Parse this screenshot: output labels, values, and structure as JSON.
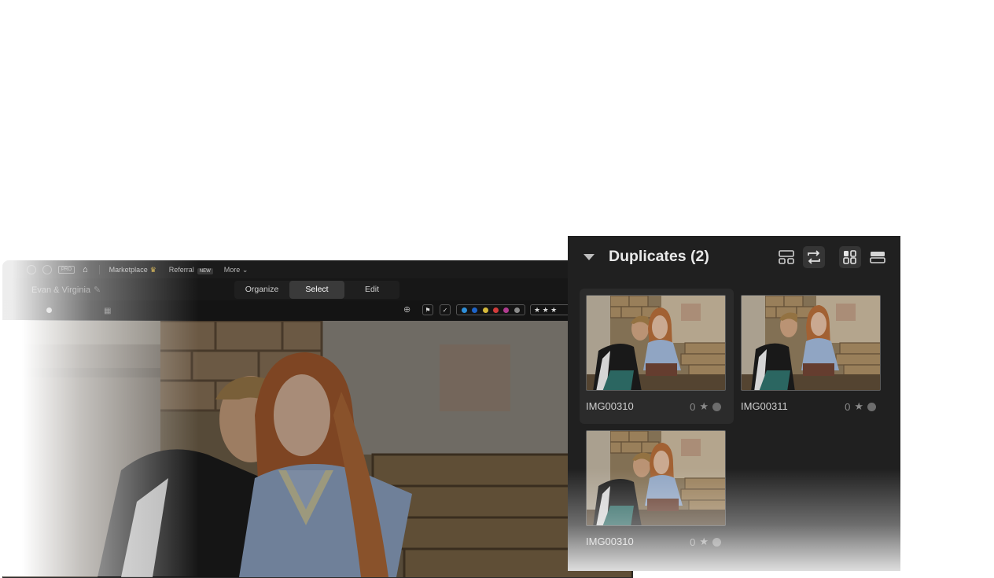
{
  "app": {
    "topbar": {
      "pro_badge": "PRO",
      "home_icon": "home-icon",
      "marketplace_label": "Marketplace",
      "referral_label": "Referral",
      "new_tag": "NEW",
      "more_label": "More"
    },
    "project_name": "Evan & Virginia",
    "modes": [
      "Organize",
      "Select",
      "Edit"
    ],
    "active_mode": "Select",
    "toolbar": {
      "zoom_icon": "zoom-in-icon",
      "color_labels": [
        "#2f8fd9",
        "#1e64c8",
        "#d6b93a",
        "#d23b3b",
        "#b03b8f",
        "#8a8a8a"
      ],
      "stars_text": "★ ★ ★"
    }
  },
  "duplicates": {
    "title": "Duplicates (2)",
    "view_buttons": [
      "stack-view-icon",
      "swap-icon",
      "grid-view-icon",
      "list-view-icon"
    ],
    "items": [
      {
        "name": "IMG00310",
        "rating": "0"
      },
      {
        "name": "IMG00311",
        "rating": "0"
      },
      {
        "name": "IMG00310",
        "rating": "0"
      }
    ]
  }
}
